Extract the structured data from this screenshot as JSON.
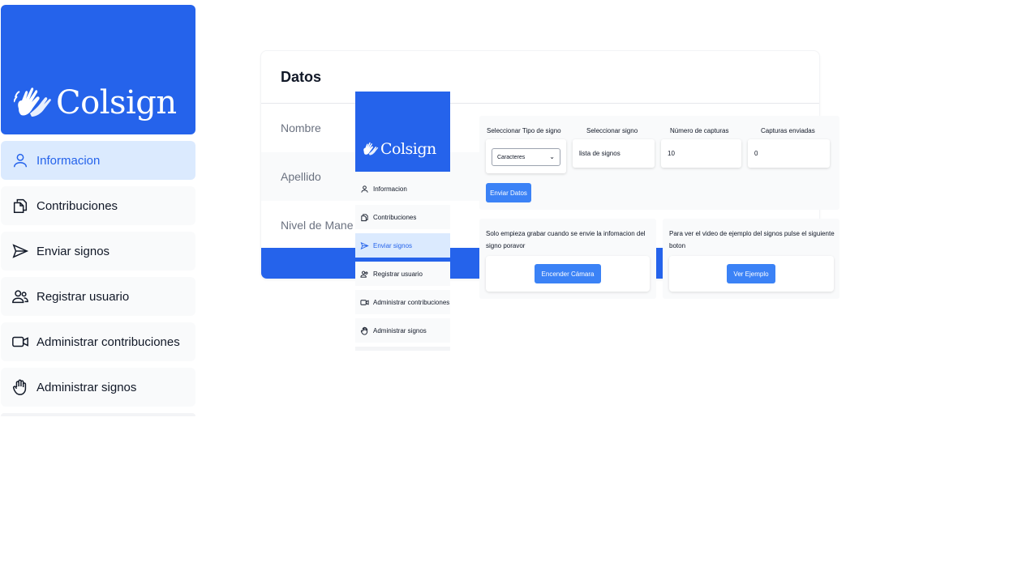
{
  "brand": {
    "name": "Colsign",
    "logo_icon": "signing-hands-icon",
    "color": "#2563eb"
  },
  "sidebar": {
    "items": [
      {
        "label": "Informacion",
        "icon": "user-icon",
        "active": true
      },
      {
        "label": "Contribuciones",
        "icon": "documents-icon",
        "active": false
      },
      {
        "label": "Enviar signos",
        "icon": "send-icon",
        "active": false
      },
      {
        "label": "Registrar usuario",
        "icon": "users-icon",
        "active": false
      },
      {
        "label": "Administrar contribuciones",
        "icon": "video-camera-icon",
        "active": false
      },
      {
        "label": "Administrar signos",
        "icon": "hand-icon",
        "active": false
      }
    ]
  },
  "datos": {
    "title": "Datos",
    "rows": [
      "Nombre",
      "Apellido",
      "Nivel de Mane"
    ]
  },
  "mini_sidebar": {
    "items": [
      {
        "label": "Informacion",
        "active": false
      },
      {
        "label": "Contribuciones",
        "active": false
      },
      {
        "label": "Enviar signos",
        "active": true
      },
      {
        "label": "Registrar usuario",
        "active": false
      },
      {
        "label": "Administrar contribuciones",
        "active": false
      },
      {
        "label": "Administrar signos",
        "active": false
      }
    ]
  },
  "form": {
    "tipo_label": "Seleccionar Tipo de signo",
    "tipo_value": "Caracteres",
    "signo_label": "Seleccionar signo",
    "signo_value": "lista de signos",
    "capturas_label": "Número de capturas",
    "capturas_value": "10",
    "enviadas_label": "Capturas enviadas",
    "enviadas_value": "0",
    "enviar_button": "Enviar Datos"
  },
  "camera": {
    "text": "Solo empieza grabar cuando se envie la infomacion del signo poravor",
    "button": "Encender Cámara"
  },
  "example": {
    "text": "Para ver el video de ejemplo del signos pulse el siguiente boton",
    "button": "Ver Ejemplo"
  }
}
